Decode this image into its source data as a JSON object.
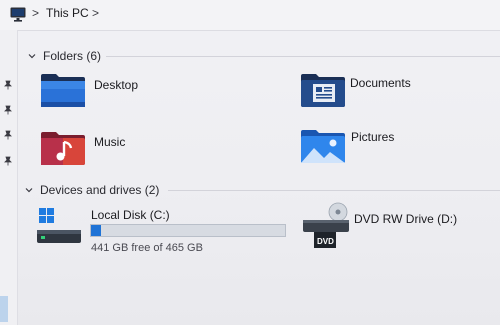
{
  "address_bar": {
    "icon": "monitor-icon",
    "separator": ">",
    "location": "This PC",
    "trailing_separator": ">"
  },
  "folders_group": {
    "title": "Folders (6)",
    "items": [
      {
        "label": "Desktop",
        "icon": "desktop-folder-icon"
      },
      {
        "label": "Documents",
        "icon": "documents-folder-icon"
      },
      {
        "label": "Music",
        "icon": "music-folder-icon"
      },
      {
        "label": "Pictures",
        "icon": "pictures-folder-icon"
      }
    ]
  },
  "devices_group": {
    "title": "Devices and drives (2)",
    "drives": [
      {
        "label": "Local Disk (C:)",
        "icon": "windows-drive-icon",
        "free_text": "441 GB free of 465 GB",
        "used_fraction": 0.05
      },
      {
        "label": "DVD RW Drive (D:)",
        "icon": "dvd-drive-icon",
        "badge": "DVD"
      }
    ]
  },
  "colors": {
    "accent": "#1f73d6",
    "folder_blue": "#1e6fd0",
    "music_red": "#d8453a"
  }
}
